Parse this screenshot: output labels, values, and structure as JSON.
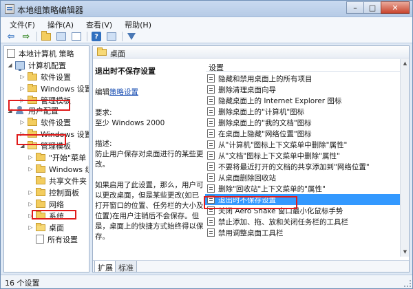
{
  "window": {
    "title": "本地组策略编辑器",
    "minimize_glyph": "–",
    "maximize_glyph": "□",
    "close_glyph": "✕"
  },
  "menu": [
    "文件(F)",
    "操作(A)",
    "查看(V)",
    "帮助(H)"
  ],
  "toolbar": {
    "buttons": [
      "back-icon",
      "forward-icon",
      "up-folder-icon",
      "show-hide-tree-icon",
      "export-list-icon",
      "help-icon",
      "properties-icon",
      "filter-icon"
    ],
    "back_glyph": "⇦",
    "forward_glyph": "⇨",
    "help_glyph": "?"
  },
  "tree": {
    "root": "本地计算机 策略",
    "computer_config": "计算机配置",
    "cc_software": "软件设置",
    "cc_windows": "Windows 设置",
    "cc_admin": "管理模板",
    "user_config": "用户配置",
    "uc_software": "软件设置",
    "uc_windows": "Windows 设置",
    "uc_admin": "管理模板",
    "start_menu": "\"开始\"菜单",
    "windows_comp": "Windows 组",
    "shared_folders": "共享文件夹",
    "control_panel": "控制面板",
    "network": "网络",
    "system": "系统",
    "desktop": "桌面",
    "all_settings": "所有设置",
    "expanded_glyph": "◢",
    "collapsed_glyph": "▷"
  },
  "right": {
    "header_title": "桌面",
    "desc_title": "退出时不保存设置",
    "edit_prefix": "编辑",
    "edit_link": "策略设置",
    "req_label": "要求:",
    "req_value": "至少 Windows 2000",
    "desc_label": "描述:",
    "desc_text": "防止用户保存对桌面进行的某些更改。",
    "desc_detail": "如果启用了此设置，那么，用户可以更改桌面，但是某些更改(如已打开窗口的位置、任务栏的大小及位置)在用户注销后不会保存。但是，桌面上的快捷方式始终得以保存。",
    "settings_header": "设置",
    "settings": [
      "隐藏和禁用桌面上的所有项目",
      "删除清理桌面向导",
      "隐藏桌面上的 Internet Explorer 图标",
      "删除桌面上的\"计算机\"图标",
      "删除桌面上的\"我的文档\"图标",
      "在桌面上隐藏\"网络位置\"图标",
      "从\"计算机\"图标上下文菜单中删除\"属性\"",
      "从\"文档\"图标上下文菜单中删除\"属性\"",
      "不要将最近打开的文档的共享添加到\"网络位置\"",
      "从桌面删除回收站",
      "删除\"回收站\"上下文菜单的\"属性\"",
      "退出时不保存设置",
      "关闭 Aero Shake 窗口最小化鼠标手势",
      "禁止添加、拖、放和关闭任务栏的工具栏",
      "禁用调整桌面工具栏"
    ],
    "selected_index": 11,
    "tabs": [
      "扩展",
      "标准"
    ],
    "scroll_up_glyph": "▲",
    "scroll_down_glyph": "▼"
  },
  "status": {
    "text": "16 个设置"
  },
  "colors": {
    "highlight": "#e01b1b",
    "selection": "#3399ff"
  }
}
